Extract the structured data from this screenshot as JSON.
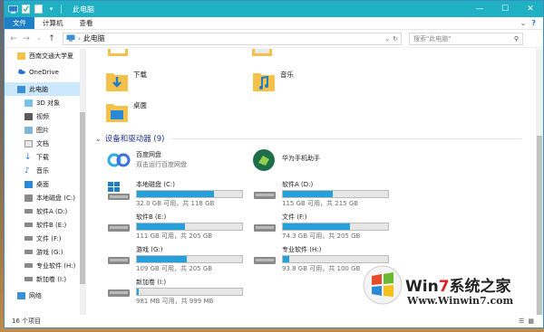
{
  "window": {
    "title": "此电脑"
  },
  "titlebar": {
    "minimize": "—",
    "maximize": "☐",
    "close": "✕"
  },
  "ribbon": {
    "tabs": [
      "文件",
      "计算机",
      "查看"
    ],
    "expand": "⌄",
    "help": "?"
  },
  "address": {
    "path": "此电脑",
    "search_placeholder": "搜索\"此电脑\""
  },
  "sidebar": {
    "items": [
      {
        "label": "西南交通大学夏",
        "icon": "folder-icon"
      },
      {
        "label": "OneDrive",
        "icon": "cloud-icon"
      },
      {
        "label": "此电脑",
        "icon": "computer-icon"
      },
      {
        "label": "3D 对象",
        "icon": "cube-icon"
      },
      {
        "label": "视频",
        "icon": "video-icon"
      },
      {
        "label": "图片",
        "icon": "picture-icon"
      },
      {
        "label": "文档",
        "icon": "document-icon"
      },
      {
        "label": "下载",
        "icon": "download-icon"
      },
      {
        "label": "音乐",
        "icon": "music-icon"
      },
      {
        "label": "桌面",
        "icon": "desktop-icon"
      },
      {
        "label": "本地磁盘 (C:)",
        "icon": "system-drive-icon"
      },
      {
        "label": "软件A (D:)",
        "icon": "drive-icon"
      },
      {
        "label": "软件B (E:)",
        "icon": "drive-icon"
      },
      {
        "label": "文件 (F:)",
        "icon": "drive-icon"
      },
      {
        "label": "游戏 (G:)",
        "icon": "drive-icon"
      },
      {
        "label": "专业软件 (H:)",
        "icon": "drive-icon"
      },
      {
        "label": "新加卷 (I:)",
        "icon": "drive-icon"
      },
      {
        "label": "网络",
        "icon": "network-icon"
      }
    ]
  },
  "folders": [
    {
      "label": "下载"
    },
    {
      "label": "音乐"
    },
    {
      "label": "桌面"
    }
  ],
  "devices_group": {
    "title": "设备和驱动器 (9)"
  },
  "apps": [
    {
      "name": "百度网盘",
      "sub": "双击运行百度网盘"
    },
    {
      "name": "华为手机助手",
      "sub": ""
    }
  ],
  "drives": [
    {
      "name": "本地磁盘 (C:)",
      "free": "32.0 GB 可用，共 118 GB",
      "used_fraction": 0.73,
      "system": true
    },
    {
      "name": "软件A (D:)",
      "free": "115 GB 可用，共 215 GB",
      "used_fraction": 0.47,
      "system": false
    },
    {
      "name": "软件B (E:)",
      "free": "111 GB 可用，共 205 GB",
      "used_fraction": 0.46,
      "system": false
    },
    {
      "name": "文件 (F:)",
      "free": "74.3 GB 可用，共 205 GB",
      "used_fraction": 0.64,
      "system": false
    },
    {
      "name": "游戏 (G:)",
      "free": "109 GB 可用，共 205 GB",
      "used_fraction": 0.47,
      "system": false
    },
    {
      "name": "专业软件 (H:)",
      "free": "93.8 GB 可用，共 100 GB",
      "used_fraction": 0.06,
      "system": false
    },
    {
      "name": "新加卷 (I:)",
      "free": "981 MB 可用，共 999 MB",
      "used_fraction": 0.02,
      "system": false
    }
  ],
  "status": {
    "count": "16 个项目"
  },
  "watermark": {
    "brand_win": "Win",
    "brand_7": "7",
    "brand_rest": "系统之家",
    "url": "Www.Winwin7.com"
  },
  "colors": {
    "titlebar": "#1fb1c3",
    "accent": "#1f7fc4",
    "usage_bar": "#26a0da",
    "group_heading": "#1e3287"
  }
}
